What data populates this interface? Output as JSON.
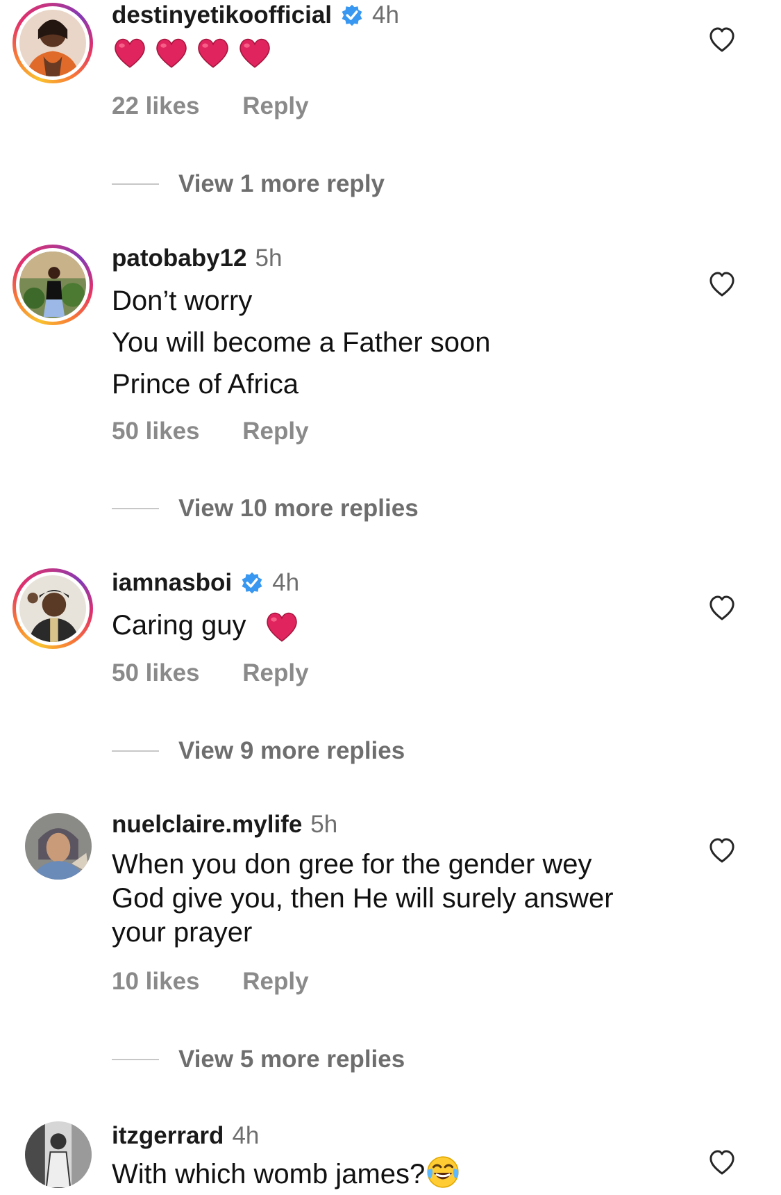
{
  "comments": [
    {
      "username": "destinyetikoofficial",
      "verified": true,
      "time": "4h",
      "emoji": "❤️❤️❤️❤️",
      "likes": "22 likes",
      "reply": "Reply",
      "view_more": "View 1 more reply",
      "avatar_story_ring": true
    },
    {
      "username": "patobaby12",
      "verified": false,
      "time": "5h",
      "lines": [
        "Don’t worry",
        "You will become a Father soon",
        "Prince of Africa"
      ],
      "likes": "50 likes",
      "reply": "Reply",
      "view_more": "View 10 more replies",
      "avatar_story_ring": true
    },
    {
      "username": "iamnasboi",
      "verified": true,
      "time": "4h",
      "text": "Caring guy",
      "emoji": "❤️",
      "likes": "50 likes",
      "reply": "Reply",
      "view_more": "View 9 more replies",
      "avatar_story_ring": true
    },
    {
      "username": "nuelclaire.mylife",
      "verified": false,
      "time": "5h",
      "lines": [
        "When you don gree for the gender wey",
        "God give you, then He will surely answer",
        "your prayer"
      ],
      "likes": "10 likes",
      "reply": "Reply",
      "view_more": "View 5 more replies",
      "avatar_story_ring": false
    },
    {
      "username": "itzgerrard",
      "verified": false,
      "time": "4h",
      "text": "With which womb james?",
      "emoji": "😂",
      "avatar_story_ring": false
    }
  ],
  "icons": {
    "like": "heart-outline-icon",
    "verified": "verified-badge-icon"
  },
  "colors": {
    "verified_blue": "#3897f0",
    "heart_red": "#e0245e",
    "muted_text": "#8a8a8a"
  }
}
